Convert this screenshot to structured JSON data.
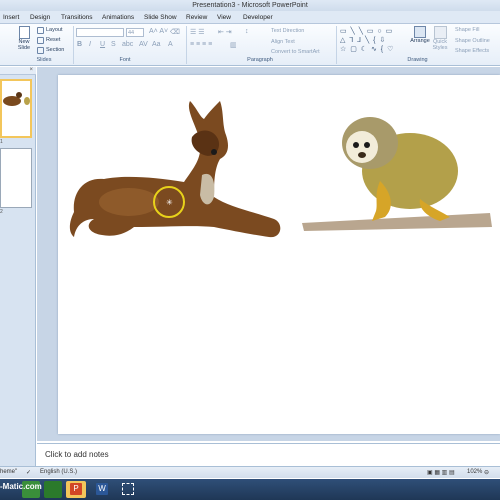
{
  "window": {
    "title": "Presentation3 - Microsoft PowerPoint"
  },
  "tabs": [
    "Insert",
    "Design",
    "Transitions",
    "Animations",
    "Slide Show",
    "Review",
    "View",
    "Developer"
  ],
  "ribbon": {
    "slides_group": {
      "label": "Slides",
      "new_slide": "New Slide",
      "layout": "Layout",
      "reset": "Reset",
      "section": "Section"
    },
    "font_group": {
      "label": "Font",
      "font_size": "44"
    },
    "paragraph_group": {
      "label": "Paragraph",
      "text_direction": "Text Direction",
      "align_text": "Align Text",
      "convert_smartart": "Convert to SmartArt"
    },
    "drawing_group": {
      "label": "Drawing",
      "arrange": "Arrange",
      "quick_styles": "Quick Styles",
      "shape_fill": "Shape Fill",
      "shape_outline": "Shape Outline",
      "shape_effects": "Shape Effects"
    }
  },
  "slide_panel": {
    "thumbnails": [
      {
        "num": "1"
      },
      {
        "num": "2"
      }
    ]
  },
  "notes": {
    "placeholder": "Click to add notes"
  },
  "status_bar": {
    "theme": "heme\"",
    "language": "English (U.S.)",
    "zoom": "102%"
  },
  "watermark": "-Matic.com",
  "colors": {
    "ribbon_bg": "#e6eef8",
    "accent": "#f3c65b",
    "cursor_ring": "#e8d21a"
  }
}
